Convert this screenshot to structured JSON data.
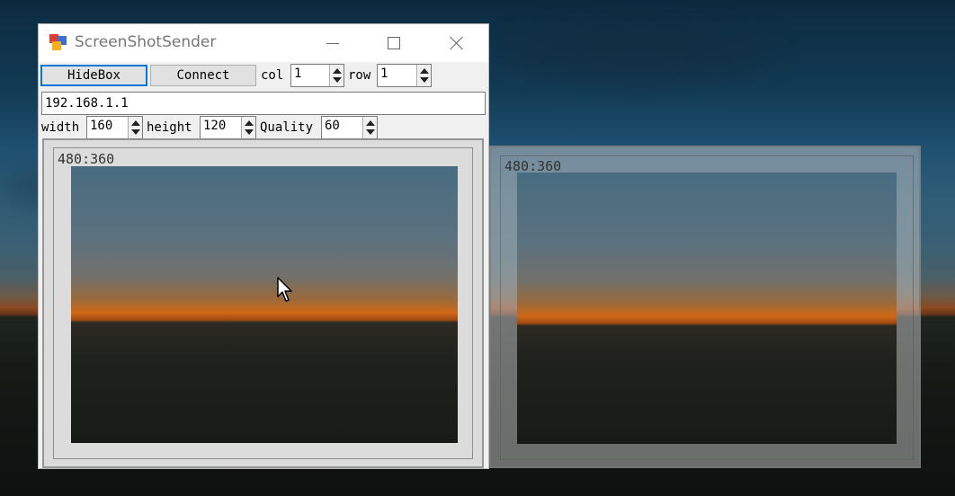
{
  "window": {
    "title": "ScreenShotSender"
  },
  "toolbar": {
    "hidebox_label": "HideBox",
    "connect_label": "Connect",
    "col_label": "col",
    "col_value": "1",
    "row_label": "row",
    "row_value": "1"
  },
  "address": {
    "value": "192.168.1.1"
  },
  "settings": {
    "width_label": "width",
    "width_value": "160",
    "height_label": "height",
    "height_value": "120",
    "quality_label": "Quality",
    "quality_value": "60"
  },
  "previews": [
    {
      "resolution": "480:360"
    },
    {
      "resolution": "480:360"
    }
  ],
  "icons": {
    "app": "app-icon",
    "minimize": "minimize-icon",
    "maximize": "maximize-icon",
    "close": "close-icon",
    "cursor": "mouse-cursor-icon"
  }
}
